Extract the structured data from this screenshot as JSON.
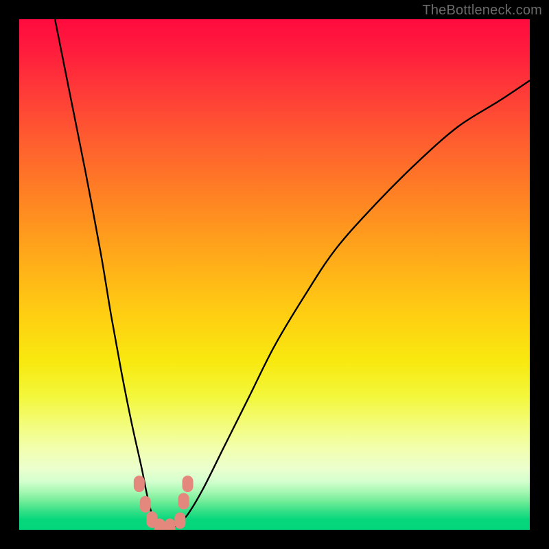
{
  "watermark": "TheBottleneck.com",
  "chart_data": {
    "type": "line",
    "title": "",
    "xlabel": "",
    "ylabel": "",
    "xlim": [
      0,
      100
    ],
    "ylim": [
      0,
      100
    ],
    "grid": false,
    "legend": false,
    "series": [
      {
        "name": "bottleneck-curve",
        "x": [
          7,
          10,
          13,
          16,
          18,
          20,
          22,
          24,
          25,
          26,
          27,
          28,
          30,
          31,
          33,
          36,
          40,
          45,
          50,
          56,
          62,
          70,
          78,
          86,
          94,
          100
        ],
        "y": [
          100,
          85,
          70,
          54,
          42,
          31,
          21,
          12,
          7,
          3,
          1,
          0.5,
          0.5,
          1,
          3,
          8,
          16,
          26,
          36,
          46,
          55,
          64,
          72,
          79,
          84,
          88
        ]
      }
    ],
    "markers": [
      {
        "x": 23.5,
        "y": 9,
        "color": "#e4887e"
      },
      {
        "x": 24.7,
        "y": 5,
        "color": "#e4887e"
      },
      {
        "x": 26.0,
        "y": 2,
        "color": "#e4887e"
      },
      {
        "x": 27.5,
        "y": 0.6,
        "color": "#e4887e"
      },
      {
        "x": 29.5,
        "y": 0.6,
        "color": "#e4887e"
      },
      {
        "x": 31.5,
        "y": 1.8,
        "color": "#e4887e"
      },
      {
        "x": 32.2,
        "y": 5.6,
        "color": "#e4887e"
      },
      {
        "x": 33.0,
        "y": 9.0,
        "color": "#e4887e"
      }
    ],
    "gradient_stops": [
      {
        "pos": 0,
        "color": "#ff0b3e"
      },
      {
        "pos": 0.5,
        "color": "#ffcf12"
      },
      {
        "pos": 0.78,
        "color": "#f3fc76"
      },
      {
        "pos": 1.0,
        "color": "#04d67c"
      }
    ]
  }
}
